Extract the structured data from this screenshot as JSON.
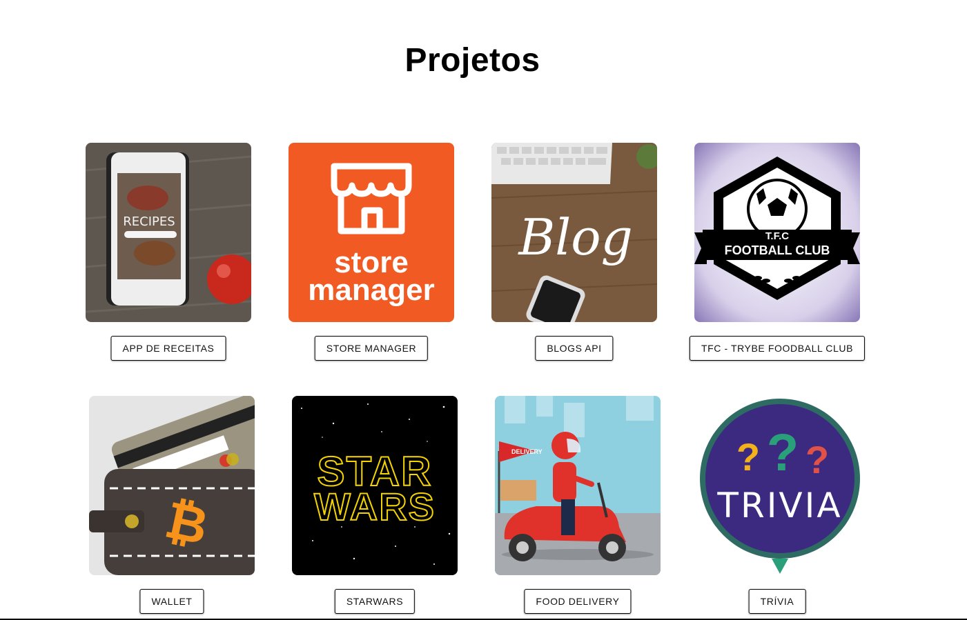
{
  "page": {
    "title": "Projetos"
  },
  "projects": [
    {
      "button_label": "APP DE RECEITAS",
      "image_text": "RECIPES"
    },
    {
      "button_label": "STORE MANAGER",
      "image_text_1": "store",
      "image_text_2": "manager"
    },
    {
      "button_label": "BLOGS API",
      "image_text": "Blog"
    },
    {
      "button_label": "TFC - TRYBE FOODBALL CLUB",
      "image_text_1": "T.F.C",
      "image_text_2": "FOOTBALL CLUB"
    },
    {
      "button_label": "WALLET",
      "image_text": "₿"
    },
    {
      "button_label": "STARWARS",
      "image_text_1": "STAR",
      "image_text_2": "WARS"
    },
    {
      "button_label": "FOOD DELIVERY",
      "image_text": "DELIVERY"
    },
    {
      "button_label": "TRÍVIA",
      "image_text": "TRIVIA"
    }
  ],
  "colors": {
    "store_orange": "#f15a22",
    "trivia_purple": "#3b2a7f",
    "trivia_teal": "#2e7d6f",
    "sky_blue": "#8ecfe0"
  }
}
